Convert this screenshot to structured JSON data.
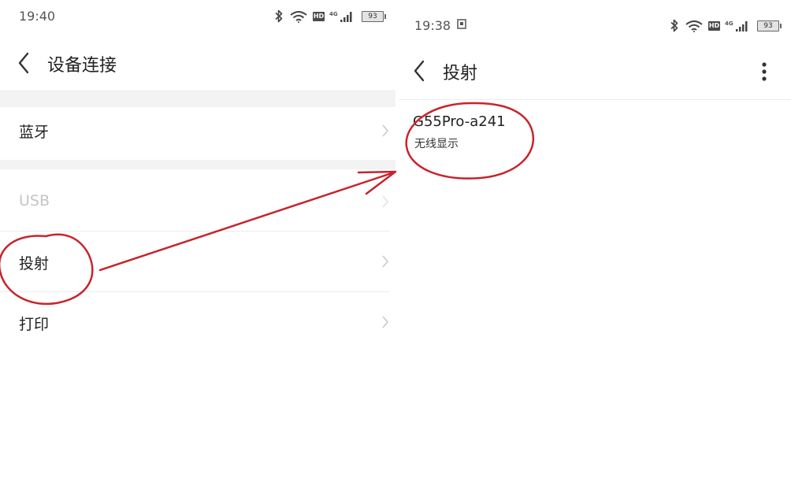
{
  "left_screen": {
    "status_bar": {
      "time": "19:40",
      "hd": "HD",
      "network": "4G",
      "battery": "93",
      "icons": [
        "bluetooth-icon",
        "wifi-icon",
        "hd-badge",
        "network-4g",
        "signal-icon",
        "battery-icon"
      ]
    },
    "title": "设备连接",
    "items": [
      {
        "label": "蓝牙",
        "enabled": true
      },
      {
        "label": "USB",
        "enabled": false
      },
      {
        "label": "投射",
        "enabled": true,
        "highlighted": true
      },
      {
        "label": "打印",
        "enabled": true
      }
    ]
  },
  "right_screen": {
    "status_bar": {
      "time": "19:38",
      "hd": "HD",
      "network": "4G",
      "battery": "93",
      "icons": [
        "screen-record-icon",
        "bluetooth-icon",
        "wifi-icon",
        "hd-badge",
        "network-4g",
        "signal-icon",
        "battery-icon"
      ]
    },
    "title": "投射",
    "devices": [
      {
        "name": "G55Pro-a241",
        "type": "无线显示",
        "highlighted": true
      }
    ]
  },
  "annotation": {
    "color": "#c8232c",
    "shapes": [
      "circle around 投射",
      "arrow to right screen",
      "circle around G55Pro-a241"
    ]
  }
}
